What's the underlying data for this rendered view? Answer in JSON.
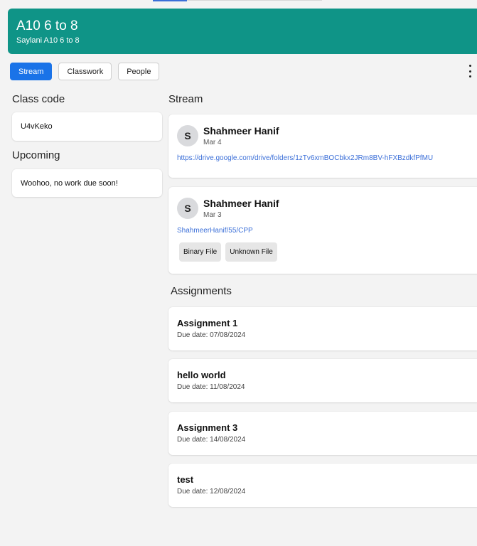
{
  "class": {
    "title": "A10 6 to 8",
    "subtitle": "Saylani A10 6 to 8"
  },
  "tabs": [
    "Stream",
    "Classwork",
    "People"
  ],
  "sidebar": {
    "class_code_heading": "Class code",
    "class_code": "U4vKeko",
    "upcoming_heading": "Upcoming",
    "upcoming_text": "Woohoo, no work due soon!"
  },
  "stream": {
    "heading": "Stream",
    "posts": [
      {
        "avatar": "S",
        "author": "Shahmeer Hanif",
        "date": "Mar 4",
        "link": "https://drive.google.com/drive/folders/1zTv6xmBOCbkx2JRm8BV-hFXBzdkfPfMU"
      },
      {
        "avatar": "S",
        "author": "Shahmeer Hanif",
        "date": "Mar 3",
        "link": "ShahmeerHanif/55/CPP",
        "attachments": [
          "Binary File",
          "Unknown File"
        ]
      }
    ]
  },
  "assignments": {
    "heading": "Assignments",
    "items": [
      {
        "title": "Assignment 1",
        "due": "Due date: 07/08/2024"
      },
      {
        "title": "hello world",
        "due": "Due date: 11/08/2024"
      },
      {
        "title": "Assignment 3",
        "due": "Due date: 14/08/2024"
      },
      {
        "title": "test",
        "due": "Due date: 12/08/2024"
      }
    ]
  },
  "colors": {
    "banner": "#0f9487",
    "accent": "#1a73e8",
    "link": "#3b6fd8"
  }
}
